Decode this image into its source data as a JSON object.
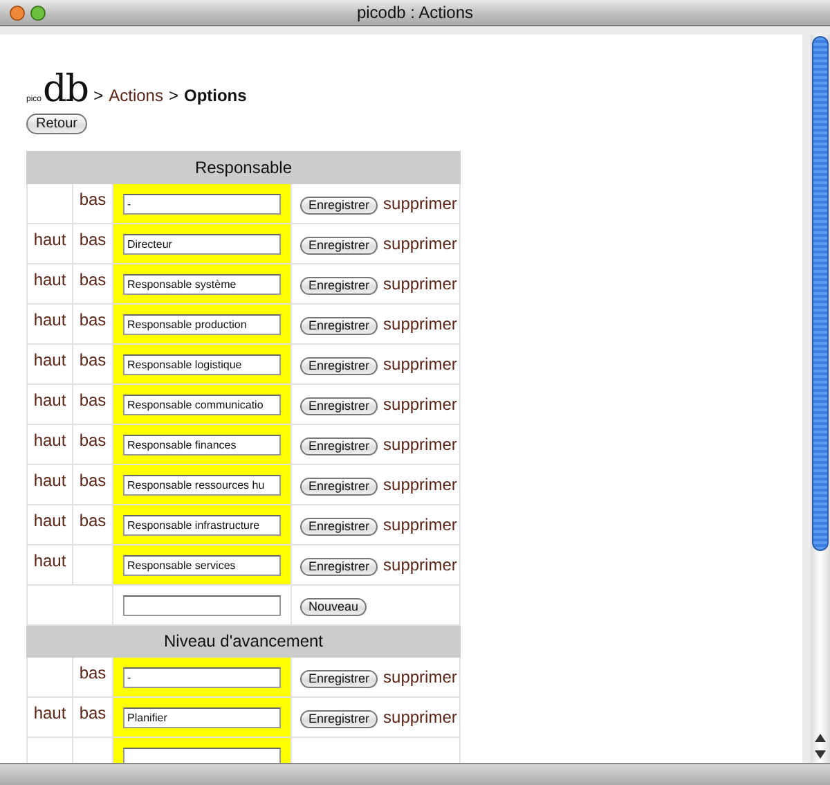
{
  "window": {
    "title": "picodb : Actions"
  },
  "breadcrumb": {
    "logo_small": "pico",
    "logo_big": "db",
    "separator_1": ">",
    "link": "Actions",
    "separator_2": ">",
    "current": "Options"
  },
  "back_button": "Retour",
  "sections": [
    {
      "title": "Responsable",
      "new_button": "Nouveau",
      "rows": [
        {
          "down": "bas",
          "value": "-",
          "save": "Enregistrer",
          "delete": "supprimer"
        },
        {
          "up": "haut",
          "down": "bas",
          "value": "Directeur",
          "save": "Enregistrer",
          "delete": "supprimer"
        },
        {
          "up": "haut",
          "down": "bas",
          "value": "Responsable système",
          "save": "Enregistrer",
          "delete": "supprimer"
        },
        {
          "up": "haut",
          "down": "bas",
          "value": "Responsable production",
          "save": "Enregistrer",
          "delete": "supprimer"
        },
        {
          "up": "haut",
          "down": "bas",
          "value": "Responsable logistique",
          "save": "Enregistrer",
          "delete": "supprimer"
        },
        {
          "up": "haut",
          "down": "bas",
          "value": "Responsable communicatio",
          "save": "Enregistrer",
          "delete": "supprimer"
        },
        {
          "up": "haut",
          "down": "bas",
          "value": "Responsable finances",
          "save": "Enregistrer",
          "delete": "supprimer"
        },
        {
          "up": "haut",
          "down": "bas",
          "value": "Responsable ressources hu",
          "save": "Enregistrer",
          "delete": "supprimer"
        },
        {
          "up": "haut",
          "down": "bas",
          "value": "Responsable infrastructure",
          "save": "Enregistrer",
          "delete": "supprimer"
        },
        {
          "up": "haut",
          "value": "Responsable services",
          "save": "Enregistrer",
          "delete": "supprimer"
        }
      ]
    },
    {
      "title": "Niveau d'avancement",
      "rows": [
        {
          "down": "bas",
          "value": "-",
          "save": "Enregistrer",
          "delete": "supprimer"
        },
        {
          "up": "haut",
          "down": "bas",
          "value": "Planifier",
          "save": "Enregistrer",
          "delete": "supprimer"
        },
        {}
      ]
    }
  ]
}
